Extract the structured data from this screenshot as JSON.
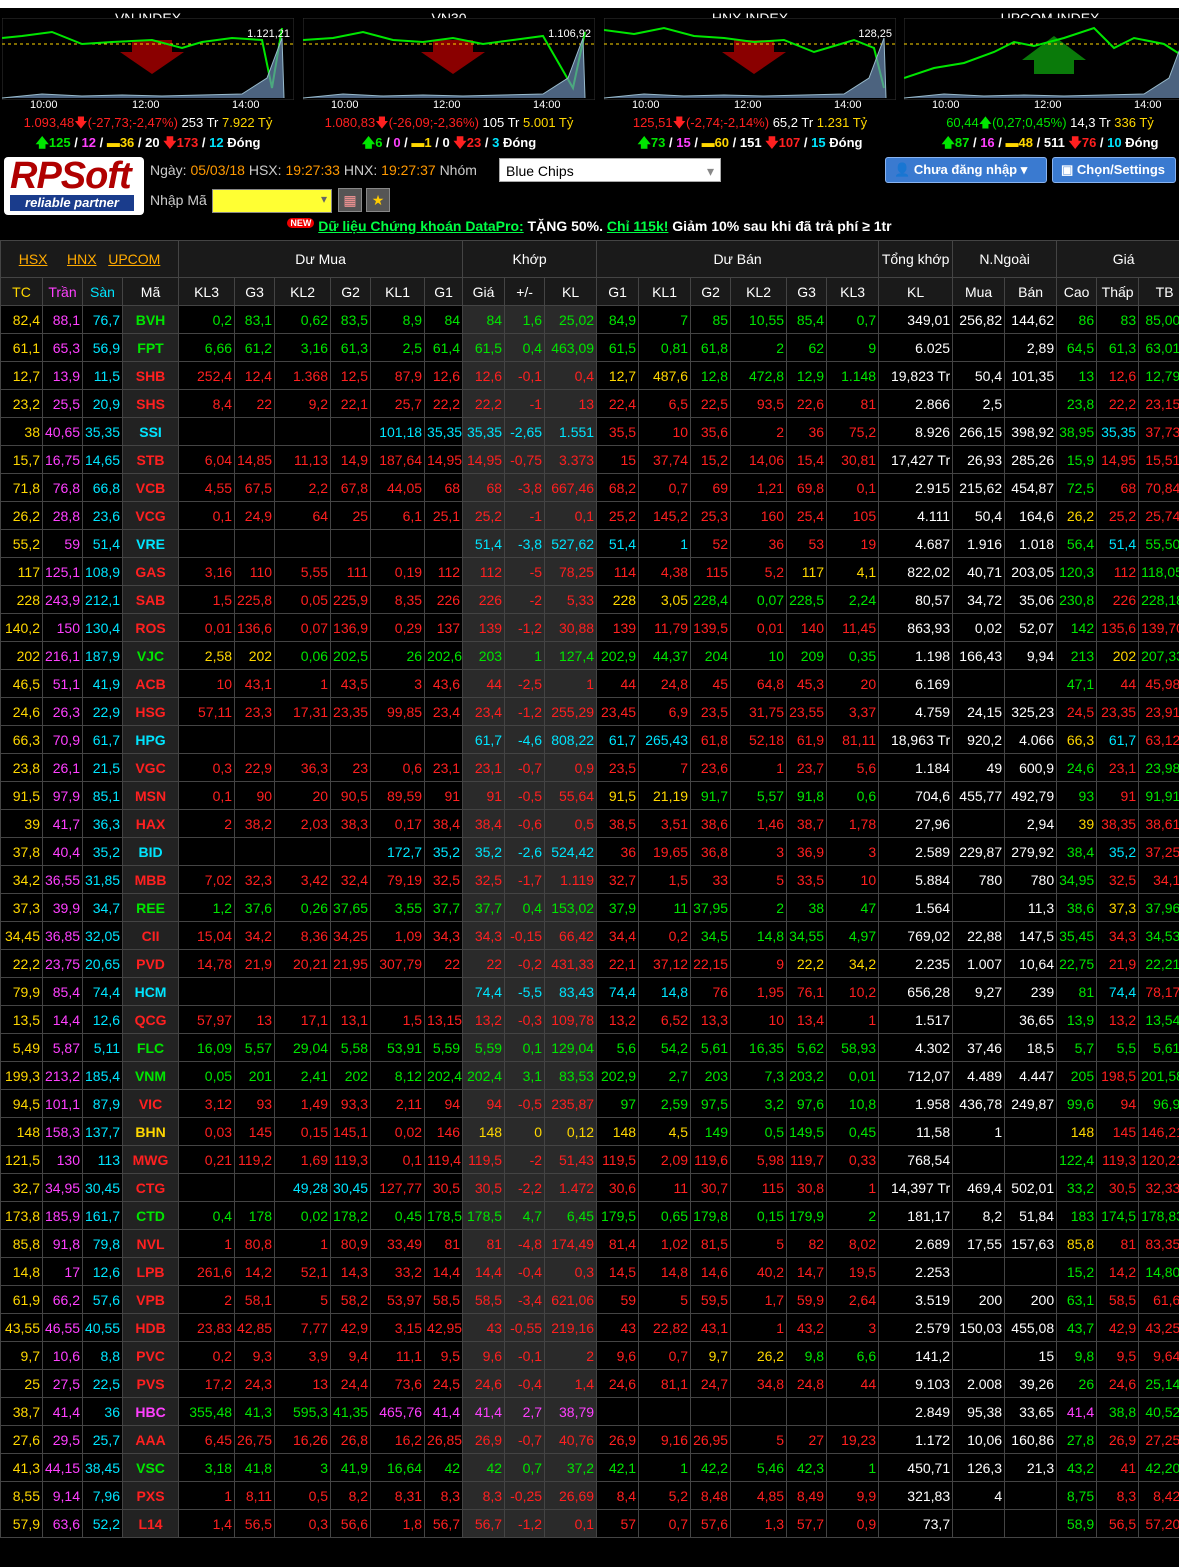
{
  "indices": [
    {
      "name": "VN INDEX",
      "level": "1.121,21",
      "times": [
        "10:00",
        "12:00",
        "14:00"
      ],
      "value": "1.093,48",
      "change": "(-27,73;-2,47%)",
      "vol": "253 Tr",
      "val": "7.922 Tỷ",
      "dir": "down",
      "up": "125",
      "ceil": "12",
      "same": "36",
      "floor_n": "20",
      "down": "173",
      "floor2": "12",
      "closed": "Đóng"
    },
    {
      "name": "VN30",
      "level": "1.106,92",
      "times": [
        "10:00",
        "12:00",
        "14:00"
      ],
      "value": "1.080,83",
      "change": "(-26,09;-2,36%)",
      "vol": "105 Tr",
      "val": "5.001 Tỷ",
      "dir": "down",
      "up": "6",
      "ceil": "0",
      "same": "1",
      "floor_n": "0",
      "down": "23",
      "floor2": "3",
      "closed": "Đóng"
    },
    {
      "name": "HNX INDEX",
      "level": "128,25",
      "times": [
        "10:00",
        "12:00",
        "14:00"
      ],
      "value": "125,51",
      "change": "(-2,74;-2,14%)",
      "vol": "65,2 Tr",
      "val": "1.231 Tỷ",
      "dir": "down",
      "up": "73",
      "ceil": "15",
      "same": "60",
      "floor_n": "151",
      "down": "107",
      "floor2": "15",
      "closed": "Đóng"
    },
    {
      "name": "UPCOM INDEX",
      "level": "",
      "times": [
        "10:00",
        "12:00",
        "14:00"
      ],
      "value": "60,44",
      "change": "(0,27;0,45%)",
      "vol": "14,3 Tr",
      "val": "336 Tỷ",
      "dir": "up",
      "up": "87",
      "ceil": "16",
      "same": "48",
      "floor_n": "511",
      "down": "76",
      "floor2": "10",
      "closed": "Đóng"
    }
  ],
  "header": {
    "logo_text": "RPSoft",
    "logo_tagline": "reliable partner",
    "date_label": "Ngày:",
    "date": "05/03/18",
    "hsx_label": "HSX:",
    "hsx_time": "19:27:33",
    "hnx_label": "HNX:",
    "hnx_time": "19:27:37",
    "group_label": "Nhóm",
    "group_value": "Blue Chips",
    "code_label": "Nhập Mã",
    "login_btn": "Chưa đăng nhập",
    "settings_btn": "Chọn/Settings"
  },
  "promo": {
    "new": "NEW",
    "link": "Dữ liệu Chứng khoán DataPro:",
    "text1": " TẶNG 50%. ",
    "link2": "Chỉ 115k!",
    "text2": " Giảm 10% sau khi đã trả phí ≥ 1tr"
  },
  "table_head": {
    "hsx": "HSX",
    "hnx": "HNX",
    "upcom": "UPCOM",
    "du_mua": "Dư Mua",
    "khop": "Khớp",
    "du_ban": "Dư Bán",
    "tong_khop": "Tổng khớp",
    "nn": "N.Ngoài",
    "gia": "Giá",
    "cols": [
      "TC",
      "Trần",
      "Sàn",
      "Mã",
      "KL3",
      "G3",
      "KL2",
      "G2",
      "KL1",
      "G1",
      "Giá",
      "+/-",
      "KL",
      "G1",
      "KL1",
      "G2",
      "KL2",
      "G3",
      "KL3",
      "KL",
      "Mua",
      "Bán",
      "Cao",
      "Thấp",
      "TB"
    ]
  },
  "rows": [
    [
      "82,4",
      "88,1",
      "76,7",
      "BVH",
      "0,2",
      "83,1",
      "0,62",
      "83,5",
      "8,9",
      "84",
      "84",
      "1,6",
      "25,02",
      "84,9",
      "7",
      "85",
      "10,55",
      "85,4",
      "0,7",
      "349,01",
      "256,82",
      "144,62",
      "86",
      "83",
      "85,007"
    ],
    [
      "61,1",
      "65,3",
      "56,9",
      "FPT",
      "6,66",
      "61,2",
      "3,16",
      "61,3",
      "2,5",
      "61,4",
      "61,5",
      "0,4",
      "463,09",
      "61,5",
      "0,81",
      "61,8",
      "2",
      "62",
      "9",
      "6.025",
      "",
      "2,89",
      "64,5",
      "61,3",
      "63,013"
    ],
    [
      "12,7",
      "13,9",
      "11,5",
      "SHB",
      "252,4",
      "12,4",
      "1.368",
      "12,5",
      "87,9",
      "12,6",
      "12,6",
      "-0,1",
      "0,4",
      "12,7",
      "487,6",
      "12,8",
      "472,8",
      "12,9",
      "1.148",
      "19,823 Tr",
      "50,4",
      "101,35",
      "13",
      "12,6",
      "12,793"
    ],
    [
      "23,2",
      "25,5",
      "20,9",
      "SHS",
      "8,4",
      "22",
      "9,2",
      "22,1",
      "25,7",
      "22,2",
      "22,2",
      "-1",
      "13",
      "22,4",
      "6,5",
      "22,5",
      "93,5",
      "22,6",
      "81",
      "2.866",
      "2,5",
      "",
      "23,8",
      "22,2",
      "23,151"
    ],
    [
      "38",
      "40,65",
      "35,35",
      "SSI",
      "",
      "",
      "",
      "",
      "101,18",
      "35,35",
      "35,35",
      "-2,65",
      "1.551",
      "35,5",
      "10",
      "35,6",
      "2",
      "36",
      "75,2",
      "8.926",
      "266,15",
      "398,92",
      "38,95",
      "35,35",
      "37,734"
    ],
    [
      "15,7",
      "16,75",
      "14,65",
      "STB",
      "6,04",
      "14,85",
      "11,13",
      "14,9",
      "187,64",
      "14,95",
      "14,95",
      "-0,75",
      "3.373",
      "15",
      "37,74",
      "15,2",
      "14,06",
      "15,4",
      "30,81",
      "17,427 Tr",
      "26,93",
      "285,26",
      "15,9",
      "14,95",
      "15,512"
    ],
    [
      "71,8",
      "76,8",
      "66,8",
      "VCB",
      "4,55",
      "67,5",
      "2,2",
      "67,8",
      "44,05",
      "68",
      "68",
      "-3,8",
      "667,46",
      "68,2",
      "0,7",
      "69",
      "1,21",
      "69,8",
      "0,1",
      "2.915",
      "215,62",
      "454,87",
      "72,5",
      "68",
      "70,842"
    ],
    [
      "26,2",
      "28,8",
      "23,6",
      "VCG",
      "0,1",
      "24,9",
      "64",
      "25",
      "6,1",
      "25,1",
      "25,2",
      "-1",
      "0,1",
      "25,2",
      "145,2",
      "25,3",
      "160",
      "25,4",
      "105",
      "4.111",
      "50,4",
      "164,6",
      "26,2",
      "25,2",
      "25,742"
    ],
    [
      "55,2",
      "59",
      "51,4",
      "VRE",
      "",
      "",
      "",
      "",
      "",
      "",
      "51,4",
      "-3,8",
      "527,62",
      "51,4",
      "1",
      "52",
      "36",
      "53",
      "19",
      "4.687",
      "1.916",
      "1.018",
      "56,4",
      "51,4",
      "55,503"
    ],
    [
      "117",
      "125,1",
      "108,9",
      "GAS",
      "3,16",
      "110",
      "5,55",
      "111",
      "0,19",
      "112",
      "112",
      "-5",
      "78,25",
      "114",
      "4,38",
      "115",
      "5,2",
      "117",
      "4,1",
      "822,02",
      "40,71",
      "203,05",
      "120,3",
      "112",
      "118,057"
    ],
    [
      "228",
      "243,9",
      "212,1",
      "SAB",
      "1,5",
      "225,8",
      "0,05",
      "225,9",
      "8,35",
      "226",
      "226",
      "-2",
      "5,33",
      "228",
      "3,05",
      "228,4",
      "0,07",
      "228,5",
      "2,24",
      "80,57",
      "34,72",
      "35,06",
      "230,8",
      "226",
      "228,186"
    ],
    [
      "140,2",
      "150",
      "130,4",
      "ROS",
      "0,01",
      "136,6",
      "0,07",
      "136,9",
      "0,29",
      "137",
      "139",
      "-1,2",
      "30,88",
      "139",
      "11,79",
      "139,5",
      "0,01",
      "140",
      "11,45",
      "863,93",
      "0,02",
      "52,07",
      "142",
      "135,6",
      "139,701"
    ],
    [
      "202",
      "216,1",
      "187,9",
      "VJC",
      "2,58",
      "202",
      "0,06",
      "202,5",
      "26",
      "202,6",
      "203",
      "1",
      "127,4",
      "202,9",
      "44,37",
      "204",
      "10",
      "209",
      "0,35",
      "1.198",
      "166,43",
      "9,94",
      "213",
      "202",
      "207,337"
    ],
    [
      "46,5",
      "51,1",
      "41,9",
      "ACB",
      "10",
      "43,1",
      "1",
      "43,5",
      "3",
      "43,6",
      "44",
      "-2,5",
      "1",
      "44",
      "24,8",
      "45",
      "64,8",
      "45,3",
      "20",
      "6.169",
      "",
      "",
      "47,1",
      "44",
      "45,987"
    ],
    [
      "24,6",
      "26,3",
      "22,9",
      "HSG",
      "57,11",
      "23,3",
      "17,31",
      "23,35",
      "99,85",
      "23,4",
      "23,4",
      "-1,2",
      "255,29",
      "23,45",
      "6,9",
      "23,5",
      "31,75",
      "23,55",
      "3,37",
      "4.759",
      "24,15",
      "325,23",
      "24,5",
      "23,35",
      "23,919"
    ],
    [
      "66,3",
      "70,9",
      "61,7",
      "HPG",
      "",
      "",
      "",
      "",
      "",
      "",
      "61,7",
      "-4,6",
      "808,22",
      "61,7",
      "265,43",
      "61,8",
      "52,18",
      "61,9",
      "81,11",
      "18,963 Tr",
      "920,2",
      "4.066",
      "66,3",
      "61,7",
      "63,121"
    ],
    [
      "23,8",
      "26,1",
      "21,5",
      "VGC",
      "0,3",
      "22,9",
      "36,3",
      "23",
      "0,6",
      "23,1",
      "23,1",
      "-0,7",
      "0,9",
      "23,5",
      "7",
      "23,6",
      "1",
      "23,7",
      "5,6",
      "1.184",
      "49",
      "600,9",
      "24,6",
      "23,1",
      "23,984"
    ],
    [
      "91,5",
      "97,9",
      "85,1",
      "MSN",
      "0,1",
      "90",
      "20",
      "90,5",
      "89,59",
      "91",
      "91",
      "-0,5",
      "55,64",
      "91,5",
      "21,19",
      "91,7",
      "5,57",
      "91,8",
      "0,6",
      "704,6",
      "455,77",
      "492,79",
      "93",
      "91",
      "91,912"
    ],
    [
      "39",
      "41,7",
      "36,3",
      "HAX",
      "2",
      "38,2",
      "2,03",
      "38,3",
      "0,17",
      "38,4",
      "38,4",
      "-0,6",
      "0,5",
      "38,5",
      "3,51",
      "38,6",
      "1,46",
      "38,7",
      "1,78",
      "27,96",
      "",
      "2,94",
      "39",
      "38,35",
      "38,616"
    ],
    [
      "37,8",
      "40,4",
      "35,2",
      "BID",
      "",
      "",
      "",
      "",
      "172,7",
      "35,2",
      "35,2",
      "-2,6",
      "524,42",
      "36",
      "19,65",
      "36,8",
      "3",
      "36,9",
      "3",
      "2.589",
      "229,87",
      "279,92",
      "38,4",
      "35,2",
      "37,252"
    ],
    [
      "34,2",
      "36,55",
      "31,85",
      "MBB",
      "7,02",
      "32,3",
      "3,42",
      "32,4",
      "79,19",
      "32,5",
      "32,5",
      "-1,7",
      "1.119",
      "32,7",
      "1,5",
      "33",
      "5",
      "33,5",
      "10",
      "5.884",
      "780",
      "780",
      "34,95",
      "32,5",
      "34,14"
    ],
    [
      "37,3",
      "39,9",
      "34,7",
      "REE",
      "1,2",
      "37,6",
      "0,26",
      "37,65",
      "3,55",
      "37,7",
      "37,7",
      "0,4",
      "153,02",
      "37,9",
      "11",
      "37,95",
      "2",
      "38",
      "47",
      "1.564",
      "",
      "11,3",
      "38,6",
      "37,3",
      "37,965"
    ],
    [
      "34,45",
      "36,85",
      "32,05",
      "CII",
      "15,04",
      "34,2",
      "8,36",
      "34,25",
      "1,09",
      "34,3",
      "34,3",
      "-0,15",
      "66,42",
      "34,4",
      "0,2",
      "34,5",
      "14,8",
      "34,55",
      "4,97",
      "769,02",
      "22,88",
      "147,5",
      "35,45",
      "34,3",
      "34,533"
    ],
    [
      "22,2",
      "23,75",
      "20,65",
      "PVD",
      "14,78",
      "21,9",
      "20,21",
      "21,95",
      "307,79",
      "22",
      "22",
      "-0,2",
      "431,33",
      "22,1",
      "37,12",
      "22,15",
      "9",
      "22,2",
      "34,2",
      "2.235",
      "1.007",
      "10,64",
      "22,75",
      "21,9",
      "22,212"
    ],
    [
      "79,9",
      "85,4",
      "74,4",
      "HCM",
      "",
      "",
      "",
      "",
      "",
      "",
      "74,4",
      "-5,5",
      "83,43",
      "74,4",
      "14,8",
      "76",
      "1,95",
      "76,1",
      "10,2",
      "656,28",
      "9,27",
      "239",
      "81",
      "74,4",
      "78,172"
    ],
    [
      "13,5",
      "14,4",
      "12,6",
      "QCG",
      "57,97",
      "13",
      "17,1",
      "13,1",
      "1,5",
      "13,15",
      "13,2",
      "-0,3",
      "109,78",
      "13,2",
      "6,52",
      "13,3",
      "10",
      "13,4",
      "1",
      "1.517",
      "",
      "36,65",
      "13,9",
      "13,2",
      "13,545"
    ],
    [
      "5,49",
      "5,87",
      "5,11",
      "FLC",
      "16,09",
      "5,57",
      "29,04",
      "5,58",
      "53,91",
      "5,59",
      "5,59",
      "0,1",
      "129,04",
      "5,6",
      "54,2",
      "5,61",
      "16,35",
      "5,62",
      "58,93",
      "4.302",
      "37,46",
      "18,5",
      "5,7",
      "5,5",
      "5,619"
    ],
    [
      "199,3",
      "213,2",
      "185,4",
      "VNM",
      "0,05",
      "201",
      "2,41",
      "202",
      "8,12",
      "202,4",
      "202,4",
      "3,1",
      "83,53",
      "202,9",
      "2,7",
      "203",
      "7,3",
      "203,2",
      "0,01",
      "712,07",
      "4.489",
      "4.447",
      "205",
      "198,5",
      "201,585"
    ],
    [
      "94,5",
      "101,1",
      "87,9",
      "VIC",
      "3,12",
      "93",
      "1,49",
      "93,3",
      "2,11",
      "94",
      "94",
      "-0,5",
      "235,87",
      "97",
      "2,59",
      "97,5",
      "3,2",
      "97,6",
      "10,8",
      "1.958",
      "436,78",
      "249,87",
      "99,6",
      "94",
      "96,92"
    ],
    [
      "148",
      "158,3",
      "137,7",
      "BHN",
      "0,03",
      "145",
      "0,15",
      "145,1",
      "0,02",
      "146",
      "148",
      "0",
      "0,12",
      "148",
      "4,5",
      "149",
      "0,5",
      "149,5",
      "0,45",
      "11,58",
      "1",
      "",
      "148",
      "145",
      "146,215"
    ],
    [
      "121,5",
      "130",
      "113",
      "MWG",
      "0,21",
      "119,2",
      "1,69",
      "119,3",
      "0,1",
      "119,4",
      "119,5",
      "-2",
      "51,43",
      "119,5",
      "2,09",
      "119,6",
      "5,98",
      "119,7",
      "0,33",
      "768,54",
      "",
      "",
      "122,4",
      "119,3",
      "120,211"
    ],
    [
      "32,7",
      "34,95",
      "30,45",
      "CTG",
      "",
      "",
      "49,28",
      "30,45",
      "127,77",
      "30,5",
      "30,5",
      "-2,2",
      "1.472",
      "30,6",
      "11",
      "30,7",
      "115",
      "30,8",
      "1",
      "14,397 Tr",
      "469,4",
      "502,01",
      "33,2",
      "30,5",
      "32,331"
    ],
    [
      "173,8",
      "185,9",
      "161,7",
      "CTD",
      "0,4",
      "178",
      "0,02",
      "178,2",
      "0,45",
      "178,5",
      "178,5",
      "4,7",
      "6,45",
      "179,5",
      "0,65",
      "179,8",
      "0,15",
      "179,9",
      "2",
      "181,17",
      "8,2",
      "51,84",
      "183",
      "174,5",
      "178,837"
    ],
    [
      "85,8",
      "91,8",
      "79,8",
      "NVL",
      "1",
      "80,8",
      "1",
      "80,9",
      "33,49",
      "81",
      "81",
      "-4,8",
      "174,49",
      "81,4",
      "1,02",
      "81,5",
      "5",
      "82",
      "8,02",
      "2.689",
      "17,55",
      "157,63",
      "85,8",
      "81",
      "83,351"
    ],
    [
      "14,8",
      "17",
      "12,6",
      "LPB",
      "261,6",
      "14,2",
      "52,1",
      "14,3",
      "33,2",
      "14,4",
      "14,4",
      "-0,4",
      "0,3",
      "14,5",
      "14,8",
      "14,6",
      "40,2",
      "14,7",
      "19,5",
      "2.253",
      "",
      "",
      "15,2",
      "14,2",
      "14,805"
    ],
    [
      "61,9",
      "66,2",
      "57,6",
      "VPB",
      "2",
      "58,1",
      "5",
      "58,2",
      "53,97",
      "58,5",
      "58,5",
      "-3,4",
      "621,06",
      "59",
      "5",
      "59,5",
      "1,7",
      "59,9",
      "2,64",
      "3.519",
      "200",
      "200",
      "63,1",
      "58,5",
      "61,69"
    ],
    [
      "43,55",
      "46,55",
      "40,55",
      "HDB",
      "23,83",
      "42,85",
      "7,77",
      "42,9",
      "3,15",
      "42,95",
      "43",
      "-0,55",
      "219,16",
      "43",
      "22,82",
      "43,1",
      "1",
      "43,2",
      "3",
      "2.579",
      "150,03",
      "455,08",
      "43,7",
      "42,9",
      "43,256"
    ],
    [
      "9,7",
      "10,6",
      "8,8",
      "PVC",
      "0,2",
      "9,3",
      "3,9",
      "9,4",
      "11,1",
      "9,5",
      "9,6",
      "-0,1",
      "2",
      "9,6",
      "0,7",
      "9,7",
      "26,2",
      "9,8",
      "6,6",
      "141,2",
      "",
      "15",
      "9,8",
      "9,5",
      "9,643"
    ],
    [
      "25",
      "27,5",
      "22,5",
      "PVS",
      "17,2",
      "24,3",
      "13",
      "24,4",
      "73,6",
      "24,5",
      "24,6",
      "-0,4",
      "1,4",
      "24,6",
      "81,1",
      "24,7",
      "34,8",
      "24,8",
      "44",
      "9.103",
      "2.008",
      "39,26",
      "26",
      "24,6",
      "25,143"
    ],
    [
      "38,7",
      "41,4",
      "36",
      "HBC",
      "355,48",
      "41,3",
      "595,3",
      "41,35",
      "465,76",
      "41,4",
      "41,4",
      "2,7",
      "38,79",
      "",
      "",
      "",
      "",
      "",
      "",
      "2.849",
      "95,38",
      "33,65",
      "41,4",
      "38,8",
      "40,529"
    ],
    [
      "27,6",
      "29,5",
      "25,7",
      "AAA",
      "6,45",
      "26,75",
      "16,26",
      "26,8",
      "16,2",
      "26,85",
      "26,9",
      "-0,7",
      "40,76",
      "26,9",
      "9,16",
      "26,95",
      "5",
      "27",
      "19,23",
      "1.172",
      "10,06",
      "160,86",
      "27,8",
      "26,9",
      "27,253"
    ],
    [
      "41,3",
      "44,15",
      "38,45",
      "VSC",
      "3,18",
      "41,8",
      "3",
      "41,9",
      "16,64",
      "42",
      "42",
      "0,7",
      "37,2",
      "42,1",
      "1",
      "42,2",
      "5,46",
      "42,3",
      "1",
      "450,71",
      "126,3",
      "21,3",
      "43,2",
      "41",
      "42,203"
    ],
    [
      "8,55",
      "9,14",
      "7,96",
      "PXS",
      "1",
      "8,11",
      "0,5",
      "8,2",
      "8,31",
      "8,3",
      "8,3",
      "-0,25",
      "26,69",
      "8,4",
      "5,2",
      "8,48",
      "4,85",
      "8,49",
      "9,9",
      "321,83",
      "4",
      "",
      "8,75",
      "8,3",
      "8,422"
    ],
    [
      "57,9",
      "63,6",
      "52,2",
      "L14",
      "1,4",
      "56,5",
      "0,3",
      "56,6",
      "1,8",
      "56,7",
      "56,7",
      "-1,2",
      "0,1",
      "57",
      "0,7",
      "57,6",
      "1,3",
      "57,7",
      "0,9",
      "73,7",
      "",
      "",
      "58,9",
      "56,5",
      "57,202"
    ]
  ],
  "colors": {
    "up": "#00e600",
    "down": "#ff2020",
    "ref": "#ffd700",
    "ceil": "#ff40ff",
    "floor": "#00e5ff",
    "neutral": "#ffffff"
  }
}
